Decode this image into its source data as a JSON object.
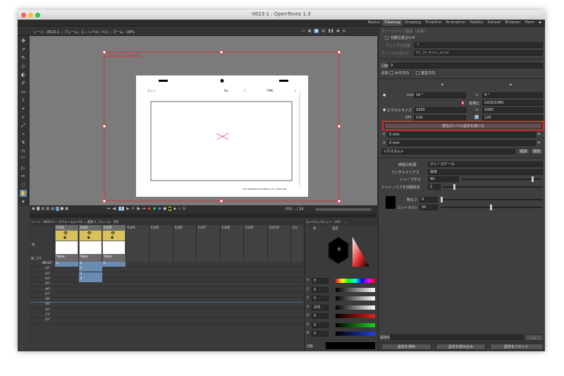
{
  "window": {
    "title": "0623-1 : OpenToonz 1.3"
  },
  "rooms": [
    "Basics",
    "Cleanup",
    "Drawing",
    "Timeline",
    "Animation",
    "Palette",
    "Xsheet",
    "Browser",
    "Farm"
  ],
  "active_room": "Cleanup",
  "viewer": {
    "header": "シーン : 0623-1 :: フレーム : 1 :: レベル : lt:1 :: ズーム : 38%",
    "cleanup_label": "Cleanup  Camera",
    "paper": {
      "cut_label": "カット",
      "no_label": "No.",
      "time_label": "TIME",
      "paren_open": "(",
      "paren_close": ")",
      "footer": "THE ANIMATION MATERIAL OF A NEW ERA"
    },
    "fps_label": "FPS -- / 24"
  },
  "colors": {
    "accent_red": "#e0242e",
    "active_blue": "#5b86b8",
    "viewer_bg": "#7b7b7b"
  },
  "xsheet": {
    "header": "シーン : 0623-1 :: 4フレームレベル :: 選択 1 フレーム : 1列",
    "komas_label": "秒 コマ",
    "columns": [
      "Col1",
      "Col2",
      "Col3",
      "Col4",
      "Col5",
      "Col6",
      "Col7",
      "Col8",
      "Col9",
      "Col10",
      "Co"
    ],
    "pegbar": [
      "Table",
      "Table",
      "Table"
    ],
    "frames": [
      "00 01\"",
      "02\"",
      "03\"",
      "04\"",
      "05\"",
      "06\"",
      "07\"",
      "08\"",
      "09\"",
      "10\"",
      "11\"",
      "12\""
    ],
    "col1_cell": "a",
    "col2_cells": [
      "b",
      "2",
      "3",
      "4"
    ],
    "col3_cell": "b"
  },
  "style_editor": {
    "header": "[レベル] パレット : [#1 : ...",
    "tabs": [
      "色",
      "設定"
    ],
    "channels": [
      {
        "name": "H",
        "value": "0"
      },
      {
        "name": "S",
        "value": "0"
      },
      {
        "name": "V",
        "value": "0"
      },
      {
        "name": "A",
        "value": "255"
      },
      {
        "name": "R",
        "value": "0"
      },
      {
        "name": "G",
        "value": "0"
      },
      {
        "name": "B",
        "value": "0"
      }
    ],
    "auto_label": "自動"
  },
  "cleanup_settings": {
    "title": "クリーンアップ設定（共通）",
    "auto_overlay": "自動位置合わせ",
    "tip_label": "ティップの位置",
    "tip_value": "下",
    "field_guide_label": "フィールドガイド",
    "field_guide_value": "fld_16_4mm_acme",
    "rotate_label": "回転",
    "rotate_value": "0",
    "flip_label": "反転",
    "flip_h": "水平方向",
    "flip_v": "垂直方向",
    "size_label": "inch",
    "size_w": "16 \"",
    "size_h": "9 \"",
    "ratio_label": "縦横比",
    "ratio_value": "1920/1080",
    "pixel_size_label": "ピクセルサイズ",
    "pixel_w": "1920",
    "pixel_h": "1080",
    "dpi_label": "DPI",
    "dpi_w": "120",
    "dpi_h": "120",
    "use_level_button": "現在のレベル設定を用いる",
    "y_label": "Y",
    "y_value": "0 mm",
    "x_label": "X",
    "x_value": "0 mm",
    "preset_value": "<カスタム>",
    "add_button": "追加",
    "delete_button": "削除",
    "line_process_label": "線幅の処理:",
    "line_process_value": "グレースケール",
    "antialias_label": "アンチエイリアス",
    "antialias_value": "標準",
    "sharpness_label": "シャープネス",
    "sharpness_value": "90",
    "sharpness_level": 0.9,
    "despeckle_label": "ドットノイズを自動除去",
    "despeckle_value": "2",
    "brightness_label": "明るさ",
    "brightness_value": "0",
    "contrast_label": "コントラスト",
    "contrast_value": "50",
    "save_path_label": "保存先",
    "browse_button": "...",
    "save_button": "設定を保存",
    "load_button": "設定を読み込み",
    "reset_button": "設定をリセット"
  }
}
